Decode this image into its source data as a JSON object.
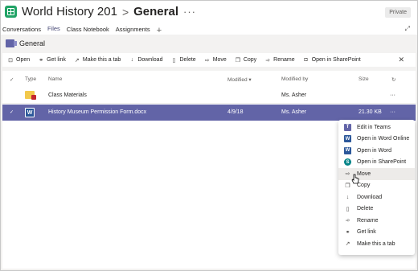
{
  "header": {
    "team_name": "World History 201",
    "separator": ">",
    "channel": "General",
    "more": "···",
    "badge": "Private"
  },
  "tabs": [
    {
      "label": "Conversations"
    },
    {
      "label": "Files"
    },
    {
      "label": "Class Notebook"
    },
    {
      "label": "Assignments"
    }
  ],
  "tab_add": "+",
  "files_section": {
    "title": "General"
  },
  "toolbar": {
    "open": "Open",
    "get_link": "Get link",
    "make_tab": "Make this a tab",
    "download": "Download",
    "delete": "Delete",
    "move": "Move",
    "copy": "Copy",
    "rename": "Rename",
    "open_sharepoint": "Open in SharePoint",
    "close": "✕"
  },
  "columns": {
    "type": "Type",
    "name": "Name",
    "modified": "Modified ▾",
    "modified_by": "Modified by",
    "size": "Size"
  },
  "rows": [
    {
      "name": "Class Materials",
      "modified": "",
      "modified_by": "Ms. Asher",
      "size": "",
      "more": "···"
    },
    {
      "name": "History Museum Permission Form.docx",
      "modified": "4/9/18",
      "modified_by": "Ms. Asher",
      "size": "21.30 KB",
      "more": "···"
    }
  ],
  "context_menu": [
    {
      "label": "Edit in Teams",
      "icon": "teams-icon"
    },
    {
      "label": "Open in Word Online",
      "icon": "word-icon"
    },
    {
      "label": "Open in Word",
      "icon": "word-icon"
    },
    {
      "label": "Open in SharePoint",
      "icon": "sharepoint-icon"
    },
    {
      "label": "Move",
      "icon": "move-icon"
    },
    {
      "label": "Copy",
      "icon": "copy-icon"
    },
    {
      "label": "Download",
      "icon": "download-icon"
    },
    {
      "label": "Delete",
      "icon": "delete-icon"
    },
    {
      "label": "Rename",
      "icon": "rename-icon"
    },
    {
      "label": "Get link",
      "icon": "link-icon"
    },
    {
      "label": "Make this a tab",
      "icon": "tab-icon"
    }
  ],
  "colors": {
    "accent": "#6264a7",
    "selected_row": "#6264a7",
    "word": "#2b579a",
    "teams_green": "#21a366"
  }
}
